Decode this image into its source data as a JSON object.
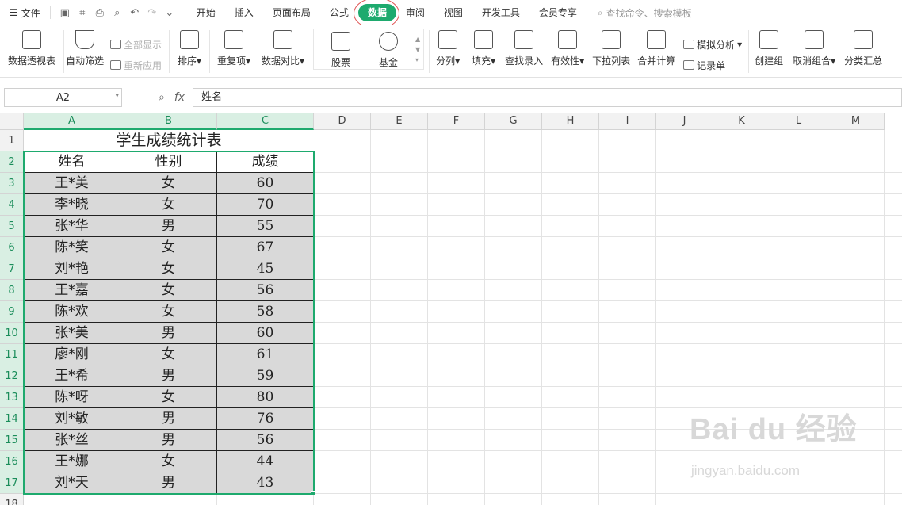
{
  "menubar": {
    "file_label": "文件",
    "tabs": [
      "开始",
      "插入",
      "页面布局",
      "公式",
      "数据",
      "审阅",
      "视图",
      "开发工具",
      "会员专享"
    ],
    "search_placeholder": "查找命令、搜索模板"
  },
  "ribbon": {
    "pivot": "数据透视表",
    "autofilter": "自动筛选",
    "show_all": "全部显示",
    "reapply": "重新应用",
    "sort": "排序",
    "duplicates": "重复项",
    "compare": "数据对比",
    "stock": "股票",
    "fund": "基金",
    "split": "分列",
    "fill": "填充",
    "lookup": "查找录入",
    "validity": "有效性",
    "dropdown": "下拉列表",
    "consolidate": "合并计算",
    "whatif": "模拟分析",
    "record": "记录单",
    "group": "创建组",
    "ungroup": "取消组合",
    "subtotal": "分类汇总"
  },
  "formula_bar": {
    "name_box": "A2",
    "formula": "姓名"
  },
  "columns": [
    "A",
    "B",
    "C",
    "D",
    "E",
    "F",
    "G",
    "H",
    "I",
    "J",
    "K",
    "L",
    "M"
  ],
  "rows": [
    "1",
    "2",
    "3",
    "4",
    "5",
    "6",
    "7",
    "8",
    "9",
    "10",
    "11",
    "12",
    "13",
    "14",
    "15",
    "16",
    "17",
    "18"
  ],
  "sheet": {
    "title": "学生成绩统计表",
    "headers": [
      "姓名",
      "性别",
      "成绩"
    ],
    "records": [
      [
        "王*美",
        "女",
        "60"
      ],
      [
        "李*晓",
        "女",
        "70"
      ],
      [
        "张*华",
        "男",
        "55"
      ],
      [
        "陈*笑",
        "女",
        "67"
      ],
      [
        "刘*艳",
        "女",
        "45"
      ],
      [
        "王*嘉",
        "女",
        "56"
      ],
      [
        "陈*欢",
        "女",
        "58"
      ],
      [
        "张*美",
        "男",
        "60"
      ],
      [
        "廖*刚",
        "女",
        "61"
      ],
      [
        "王*希",
        "男",
        "59"
      ],
      [
        "陈*呀",
        "女",
        "80"
      ],
      [
        "刘*敏",
        "男",
        "76"
      ],
      [
        "张*丝",
        "男",
        "56"
      ],
      [
        "王*娜",
        "女",
        "44"
      ],
      [
        "刘*天",
        "男",
        "43"
      ]
    ]
  },
  "watermark": {
    "brand": "Bai du 经验",
    "url": "jingyan.baidu.com"
  },
  "colors": {
    "accent": "#1eaa6e",
    "highlight_circle": "#e05555",
    "data_fill": "#d9d9d9"
  }
}
